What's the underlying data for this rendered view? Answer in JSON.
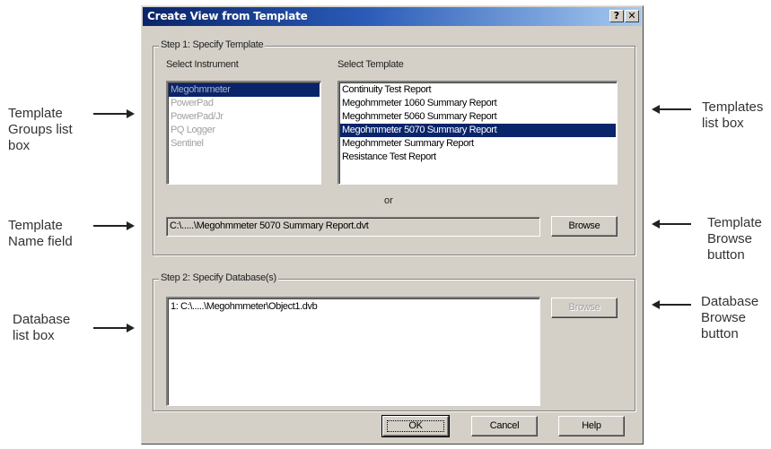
{
  "dialog": {
    "title": "Create View from Template",
    "help_glyph": "?",
    "close_glyph": "✕",
    "step1": {
      "legend": "Step 1: Specify Template",
      "instrument_label": "Select Instrument",
      "template_label": "Select Template",
      "instruments": [
        "Megohmmeter",
        "PowerPad",
        "PowerPad/Jr",
        "PQ Logger",
        "Sentinel"
      ],
      "selected_instrument": "Megohmmeter",
      "templates": [
        "Continuity Test Report",
        "Megohmmeter 1060 Summary Report",
        "Megohmmeter 5060 Summary Report",
        "Megohmmeter 5070 Summary Report",
        "Megohmmeter Summary Report",
        "Resistance Test Report"
      ],
      "selected_template": "Megohmmeter 5070 Summary Report",
      "or_text": "or",
      "template_path": "C:\\.....\\Megohmmeter 5070 Summary Report.dvt",
      "browse_label": "Browse"
    },
    "step2": {
      "legend": "Step 2: Specify Database(s)",
      "databases": [
        "1: C:\\.....\\Megohmmeter\\Object1.dvb"
      ],
      "browse_label": "Browse",
      "browse_enabled": false
    },
    "buttons": {
      "ok": "OK",
      "cancel": "Cancel",
      "help": "Help"
    }
  },
  "callouts": {
    "template_groups": "Template\nGroups list\nbox",
    "template_name": "Template\nName field",
    "database_list": "Database\nlist box",
    "templates_list": "Templates\nlist box",
    "template_browse": "Template\nBrowse\nbutton",
    "database_browse": "Database\nBrowse\nbutton"
  },
  "colors": {
    "selection": "#0a246a",
    "dialog_face": "#d4d0c8",
    "titlebar_start": "#0a246a",
    "titlebar_end": "#a6caf0"
  }
}
